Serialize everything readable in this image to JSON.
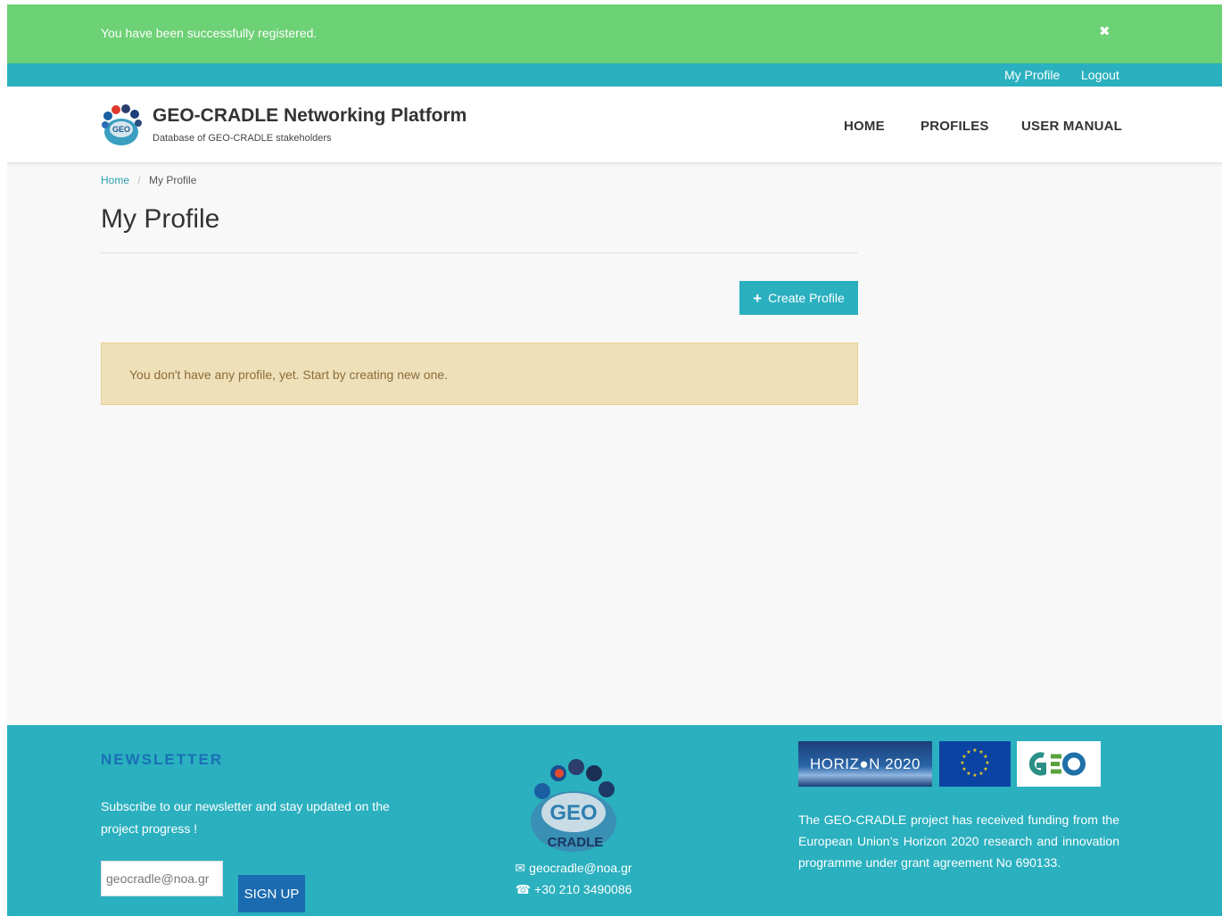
{
  "alert": {
    "message": "You have been successfully registered.",
    "close_icon": "times-icon"
  },
  "topbar": {
    "my_profile": "My Profile",
    "logout": "Logout"
  },
  "navbar": {
    "brand_title": "GEO-CRADLE Networking Platform",
    "brand_subtitle": "Database of GEO-CRADLE stakeholders",
    "items": [
      "HOME",
      "PROFILES",
      "USER MANUAL"
    ]
  },
  "breadcrumb": {
    "home": "Home",
    "separator": "/",
    "current": "My Profile"
  },
  "main": {
    "title": "My Profile",
    "create_button": "Create Profile",
    "create_icon": "plus-icon",
    "empty_message": "You don't have any profile, yet. Start by creating new one."
  },
  "footer": {
    "newsletter_title": "NEWSLETTER",
    "newsletter_text": "Subscribe to our newsletter and stay updated on the project progress !",
    "email_placeholder": "geocradle@noa.gr",
    "signup_button": "SIGN UP",
    "contact_email": "geocradle@noa.gr",
    "contact_phone": "+30 210 3490086",
    "horizon_logo_text": "HORIZ●N 2020",
    "funding_text": "The GEO-CRADLE project has received funding from the European Union’s Horizon 2020 research and innovation programme under grant agreement No 690133."
  },
  "colors": {
    "success": "#6dd175",
    "teal": "#2ab0bf",
    "warning_bg": "#eee0b9",
    "warning_text": "#8a6d3b",
    "newsletter_title": "#1a6fb5",
    "signup_bg": "#1a6bb0"
  }
}
